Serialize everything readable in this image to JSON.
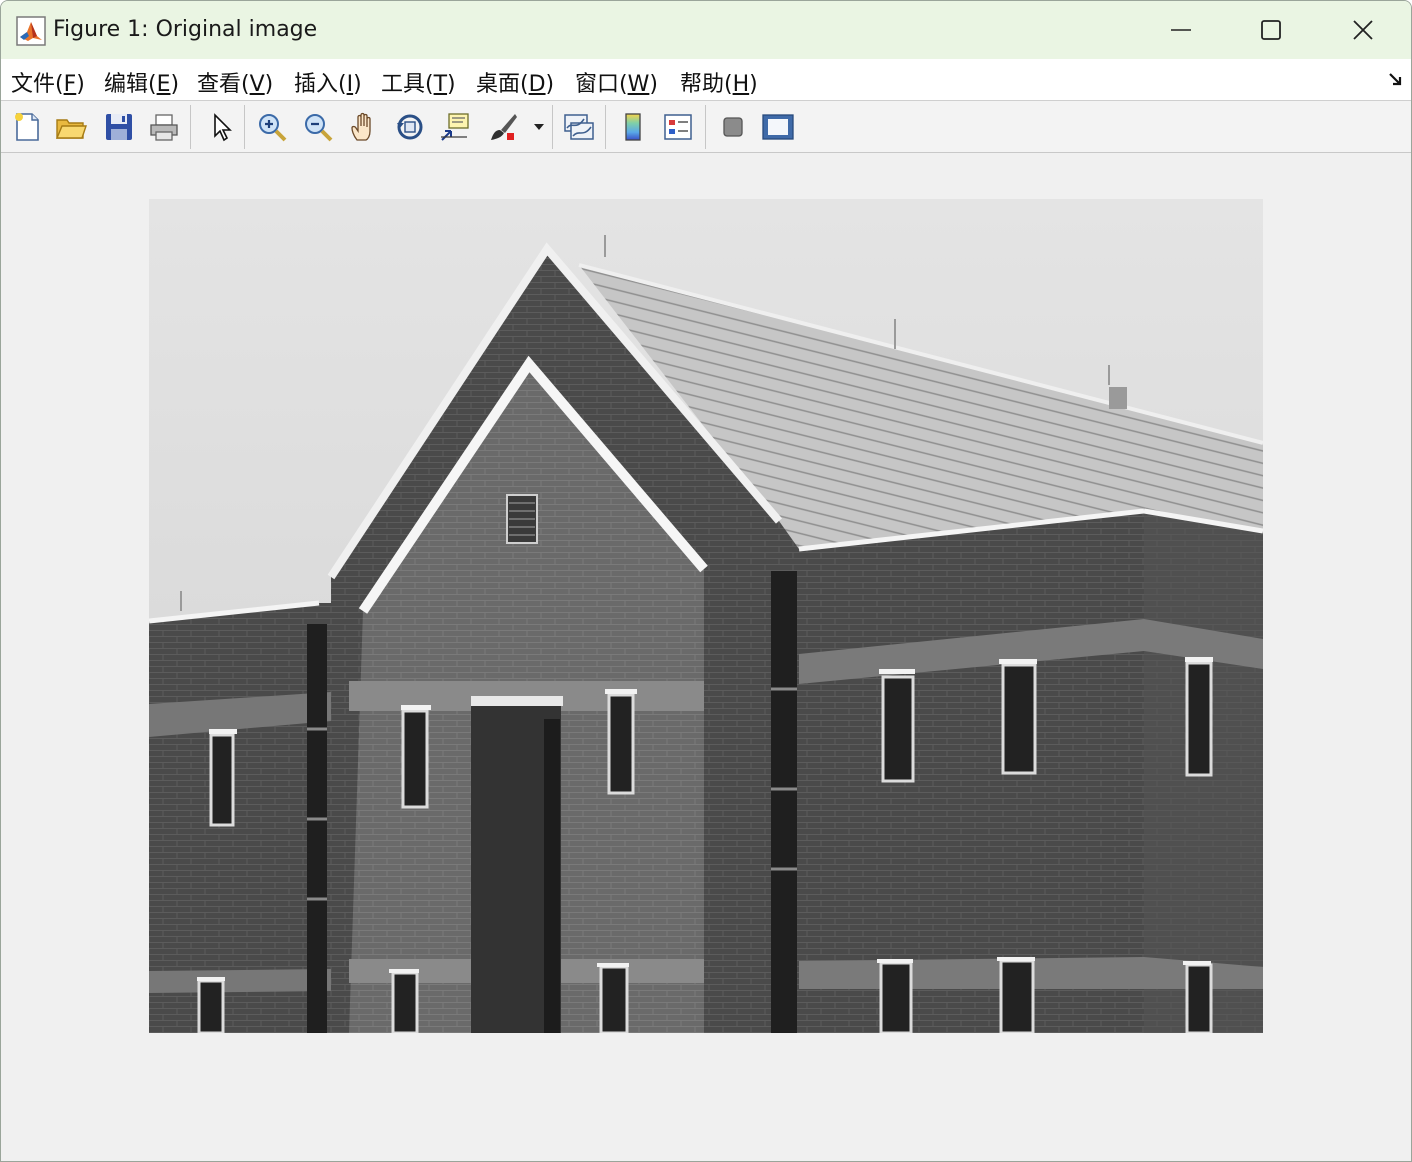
{
  "window": {
    "title": "Figure 1: Original image"
  },
  "menu": {
    "items": [
      {
        "text": "文件(",
        "key": "F",
        "close": ")"
      },
      {
        "text": "编辑(",
        "key": "E",
        "close": ")"
      },
      {
        "text": "查看(",
        "key": "V",
        "close": ")"
      },
      {
        "text": "插入(",
        "key": "I",
        "close": ")"
      },
      {
        "text": "工具(",
        "key": "T",
        "close": ")"
      },
      {
        "text": "桌面(",
        "key": "D",
        "close": ")"
      },
      {
        "text": "窗口(",
        "key": "W",
        "close": ")"
      },
      {
        "text": "帮助(",
        "key": "H",
        "close": ")"
      }
    ]
  },
  "toolbar": {
    "icons": [
      "new-figure-icon",
      "open-file-icon",
      "save-icon",
      "print-icon",
      "pointer-icon",
      "zoom-in-icon",
      "zoom-out-icon",
      "pan-hand-icon",
      "rotate-3d-icon",
      "data-cursor-icon",
      "brush-icon",
      "brush-dropdown-icon",
      "link-plot-icon",
      "colorbar-icon",
      "legend-icon",
      "hide-plot-tools-icon",
      "show-plot-tools-icon"
    ]
  },
  "colors": {
    "titlebar": "#eaf5e3",
    "accent": "#e8732a"
  }
}
